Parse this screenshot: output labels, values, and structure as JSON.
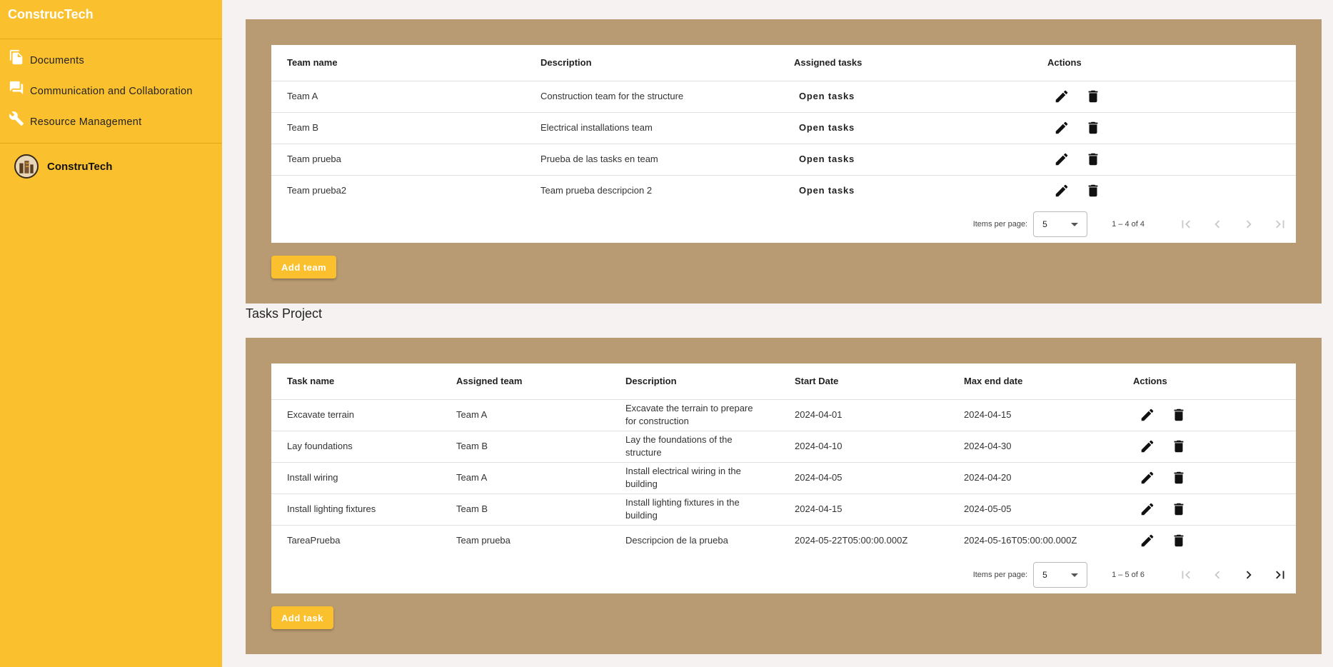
{
  "app": {
    "title": "ConstrucTech"
  },
  "sidebar": {
    "items": [
      {
        "label": "Documents",
        "icon": "documents-icon"
      },
      {
        "label": "Communication and Collaboration",
        "icon": "chat-icon"
      },
      {
        "label": "Resource Management",
        "icon": "wrench-icon"
      }
    ],
    "profile": {
      "name": "ConstruTech"
    }
  },
  "teams": {
    "columns": [
      "Team name",
      "Description",
      "Assigned tasks",
      "Actions"
    ],
    "rows": [
      {
        "name": "Team A",
        "description": "Construction team for the structure",
        "link": "Open tasks"
      },
      {
        "name": "Team B",
        "description": "Electrical installations team",
        "link": "Open tasks"
      },
      {
        "name": "Team prueba",
        "description": "Prueba de las tasks en team",
        "link": "Open tasks"
      },
      {
        "name": "Team prueba2",
        "description": "Team prueba descripcion 2",
        "link": "Open tasks"
      }
    ],
    "paginator": {
      "label": "Items per page:",
      "page_size": "5",
      "range": "1 – 4 of 4"
    },
    "add_label": "Add team"
  },
  "tasks": {
    "title": "Tasks Project",
    "columns": [
      "Task name",
      "Assigned team",
      "Description",
      "Start Date",
      "Max end date",
      "Actions"
    ],
    "rows": [
      {
        "name": "Excavate terrain",
        "team": "Team A",
        "description": "Excavate the terrain to prepare for construction",
        "start": "2024-04-01",
        "end": "2024-04-15"
      },
      {
        "name": "Lay foundations",
        "team": "Team B",
        "description": "Lay the foundations of the structure",
        "start": "2024-04-10",
        "end": "2024-04-30"
      },
      {
        "name": "Install wiring",
        "team": "Team A",
        "description": "Install electrical wiring in the building",
        "start": "2024-04-05",
        "end": "2024-04-20"
      },
      {
        "name": "Install lighting fixtures",
        "team": "Team B",
        "description": "Install lighting fixtures in the building",
        "start": "2024-04-15",
        "end": "2024-05-05"
      },
      {
        "name": "TareaPrueba",
        "team": "Team prueba",
        "description": "Descripcion de la prueba",
        "start": "2024-05-22T05:00:00.000Z",
        "end": "2024-05-16T05:00:00.000Z"
      }
    ],
    "paginator": {
      "label": "Items per page:",
      "page_size": "5",
      "range": "1 – 5 of 6"
    },
    "add_label": "Add task"
  },
  "colors": {
    "sidebar": "#fbc02d",
    "panel": "#b89b72",
    "accent": "#fbc02d"
  }
}
